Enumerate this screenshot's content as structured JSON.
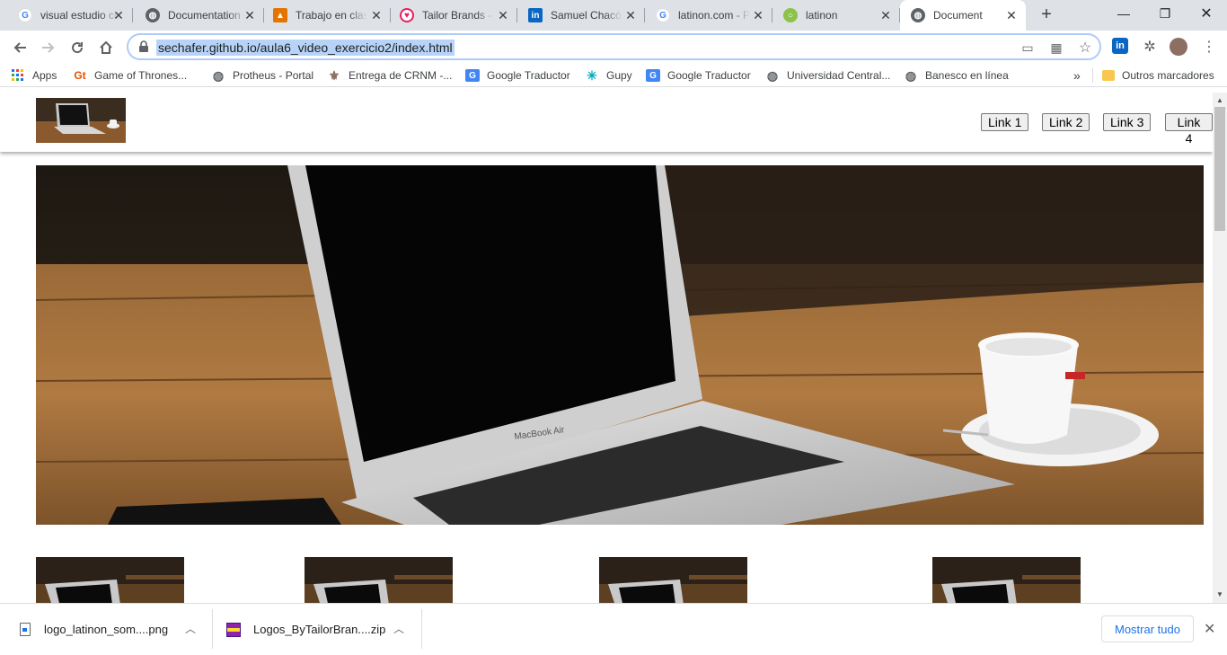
{
  "tabs": [
    {
      "title": "visual estudio code",
      "favicon": "google-icon",
      "color": "#4285f4",
      "active": false
    },
    {
      "title": "Documentation",
      "favicon": "globe-icon",
      "color": "#5f6368",
      "active": false
    },
    {
      "title": "Trabajo en clase",
      "favicon": "classroom-icon",
      "color": "#e37400",
      "active": false
    },
    {
      "title": "Tailor Brands - Logo",
      "favicon": "heart-icon",
      "color": "#e91e63",
      "active": false
    },
    {
      "title": "Samuel Chacón",
      "favicon": "linkedin-icon",
      "color": "#0a66c2",
      "active": false
    },
    {
      "title": "latinon.com - Pesquisa",
      "favicon": "google-icon",
      "color": "#4285f4",
      "active": false
    },
    {
      "title": "latinon",
      "favicon": "latinon-icon",
      "color": "#8bc34a",
      "active": false
    },
    {
      "title": "Document",
      "favicon": "globe-icon",
      "color": "#5f6368",
      "active": true
    }
  ],
  "address_bar": {
    "url": "sechafer.github.io/aula6_video_exercicio2/index.html"
  },
  "bookmarks": [
    {
      "label": "Apps",
      "icon": "apps-grid-icon"
    },
    {
      "label": "Game of Thrones...",
      "icon": "gt-icon"
    },
    {
      "label": "Protheus - Portal",
      "icon": "globe-icon"
    },
    {
      "label": "Entrega de CRNM -...",
      "icon": "seal-icon"
    },
    {
      "label": "Google Traductor",
      "icon": "translate-icon"
    },
    {
      "label": "Gupy",
      "icon": "gupy-icon"
    },
    {
      "label": "Google Traductor",
      "icon": "translate-icon"
    },
    {
      "label": "Universidad Central...",
      "icon": "globe-icon"
    },
    {
      "label": "Banesco en línea",
      "icon": "globe-icon"
    }
  ],
  "bookmarks_overflow": "»",
  "other_bookmarks": "Outros marcadores",
  "page": {
    "nav_links": [
      "Link 1",
      "Link 2",
      "Link 3",
      "Link 4"
    ],
    "hero_brand": "MacBook Air"
  },
  "downloads": {
    "items": [
      {
        "filename": "logo_latinon_som....png",
        "icon": "png-file-icon"
      },
      {
        "filename": "Logos_ByTailorBran....zip",
        "icon": "zip-archive-icon"
      }
    ],
    "show_all": "Mostrar tudo"
  },
  "colors": {
    "accent": "#1a73e8",
    "tabstrip": "#dee1e6",
    "url_selection": "#b7d3f7"
  }
}
